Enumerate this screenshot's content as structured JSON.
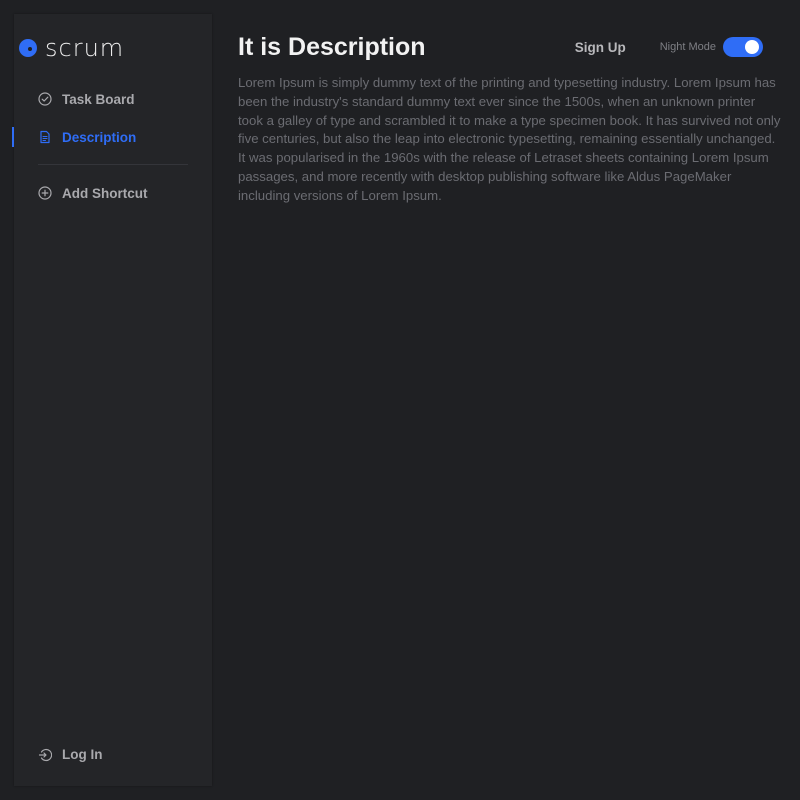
{
  "brand": {
    "name": "scrum",
    "accent_color": "#2f6df6"
  },
  "sidebar": {
    "items": [
      {
        "label": "Task Board",
        "icon": "check-circle-icon",
        "active": false
      },
      {
        "label": "Description",
        "icon": "document-icon",
        "active": true
      },
      {
        "label": "Add Shortcut",
        "icon": "plus-circle-icon",
        "active": false
      }
    ],
    "footer": {
      "label": "Log In",
      "icon": "login-icon"
    }
  },
  "header": {
    "title": "It is Description",
    "signup_label": "Sign Up",
    "night_mode_label": "Night Mode",
    "night_mode_on": true
  },
  "main": {
    "description": "Lorem Ipsum is simply dummy text of the printing and typesetting industry. Lorem Ipsum has been the industry's standard dummy text ever since the 1500s, when an unknown printer took a galley of type and scrambled it to make a type specimen book. It has survived not only five centuries, but also the leap into electronic typesetting, remaining essentially unchanged. It was popularised in the 1960s with the release of Letraset sheets containing Lorem Ipsum passages, and more recently with desktop publishing software like Aldus PageMaker including versions of Lorem Ipsum."
  }
}
